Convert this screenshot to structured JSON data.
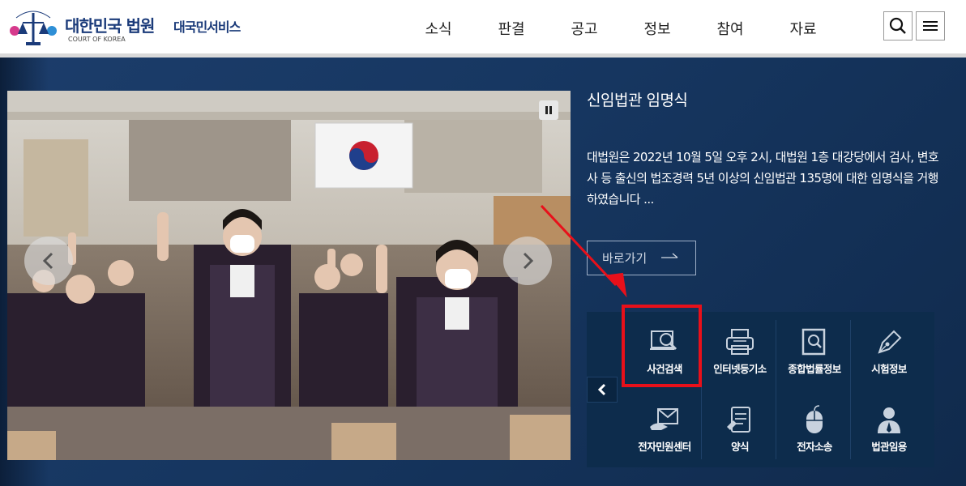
{
  "header": {
    "logo_title": "대한민국 법원",
    "logo_sub": "COURT OF KOREA",
    "service": "대국민서비스",
    "emblem_text": "대한민국법원",
    "nav": [
      "소식",
      "판결",
      "공고",
      "정보",
      "참여",
      "자료"
    ],
    "search_icon": "search-icon",
    "menu_icon": "hamburger-menu-icon"
  },
  "hero": {
    "title": "신임법관 임명식",
    "body": "대법원은 2022년 10월 5일 오후 2시, 대법원 1층 대강당에서 검사, 변호사 등 출신의 법조경력 5년 이상의 신임법관 135명에 대한 임명식을 거행하였습니다 ...",
    "goto_label": "바로가기",
    "pause_icon": "pause-icon",
    "prev_icon": "chevron-left-icon",
    "next_icon": "chevron-right-icon"
  },
  "quick_menu": {
    "prev_icon": "chevron-left-icon",
    "items": [
      {
        "label": "사건검색",
        "icon": "case-search-icon"
      },
      {
        "label": "인터넷등기소",
        "icon": "printer-icon"
      },
      {
        "label": "종합법률정보",
        "icon": "legal-info-icon"
      },
      {
        "label": "시험정보",
        "icon": "pen-nib-icon"
      },
      {
        "label": "전자민원센터",
        "icon": "mail-hand-icon"
      },
      {
        "label": "양식",
        "icon": "form-document-icon"
      },
      {
        "label": "전자소송",
        "icon": "mouse-icon"
      },
      {
        "label": "법관임용",
        "icon": "judge-person-icon"
      }
    ]
  },
  "colors": {
    "brand": "#1b3b7a",
    "hero_bg": "#163660",
    "quick_bg": "#0d2c4c",
    "highlight": "#e8101a"
  }
}
